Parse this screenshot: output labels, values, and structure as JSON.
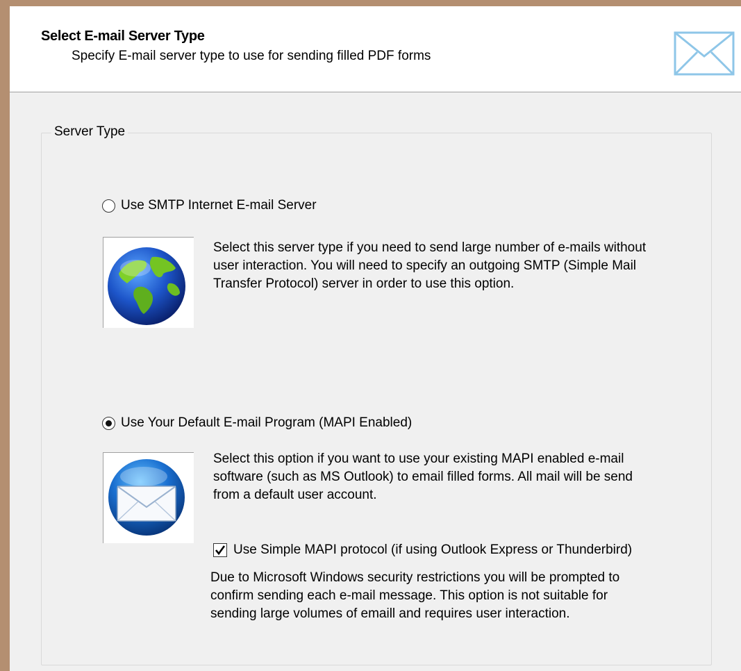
{
  "header": {
    "title": "Select E-mail Server Type",
    "subtitle": "Specify E-mail server type to use for sending filled PDF forms",
    "icon": "envelope-icon"
  },
  "group": {
    "legend": "Server Type"
  },
  "options": {
    "smtp": {
      "label": "Use SMTP Internet E-mail Server",
      "selected": false,
      "icon": "globe-icon",
      "description": "Select this server type if you need to send large number of e-mails without user interaction. You will need to specify an outgoing SMTP (Simple Mail Transfer Protocol) server in order to use this option."
    },
    "mapi": {
      "label": "Use Your Default E-mail Program (MAPI Enabled)",
      "selected": true,
      "icon": "mail-orb-icon",
      "description": "Select this option if you want to use your existing MAPI enabled e-mail software (such as MS Outlook) to email filled forms. All mail will be send from a default user account.",
      "simple_mapi": {
        "label": "Use Simple MAPI protocol (if using Outlook Express or Thunderbird)",
        "checked": true
      },
      "note": "Due to Microsoft Windows security restrictions you will be prompted to confirm sending each e-mail message. This option is not suitable for sending large volumes of emaill and requires user interaction."
    }
  },
  "colors": {
    "window_border": "#b48f71",
    "header_bg": "#ffffff",
    "panel_bg": "#f0f0f0",
    "icon_blue": "#8ec6e8"
  }
}
